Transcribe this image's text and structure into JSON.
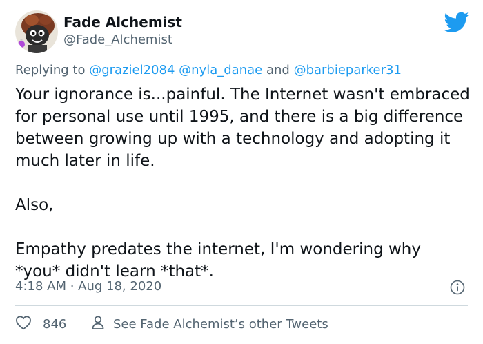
{
  "author": {
    "name": "Fade Alchemist",
    "handle": "@Fade_Alchemist"
  },
  "reply": {
    "prefix": "Replying to",
    "mention1": "@graziel2084",
    "mention2": "@nyla_danae",
    "conjunction": "and",
    "mention3": "@barbieparker31"
  },
  "tweet": {
    "paragraph1": "Your ignorance is...painful. The Internet wasn't embraced for personal use until 1995, and there is a big difference between growing up with a technology and adopting it much later in life.",
    "paragraph2": "Also,",
    "paragraph3": "Empathy predates the internet, I'm wondering why *you* didn't learn *that*.",
    "timestamp": "4:18 AM · Aug 18, 2020"
  },
  "actions": {
    "like_count": "846",
    "other_tweets_label": "See Fade Alchemist’s other Tweets"
  },
  "icons": {
    "brand": "twitter-bird-icon",
    "info": "info-icon",
    "like": "heart-icon",
    "profile": "person-icon"
  },
  "colors": {
    "accent": "#1d9bf0",
    "text": "#0f1419",
    "secondary": "#536471",
    "divider": "#cfd9de"
  }
}
